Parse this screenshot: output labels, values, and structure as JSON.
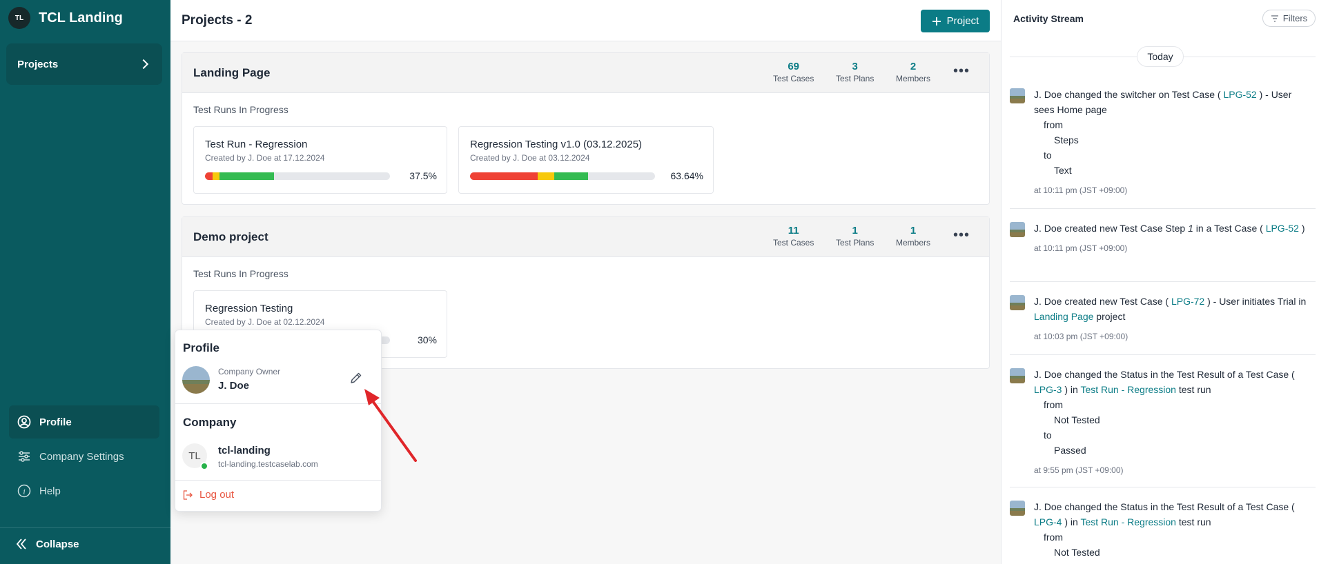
{
  "sidebar": {
    "brand_initials": "TL",
    "brand_title": "TCL Landing",
    "projects_label": "Projects",
    "profile_label": "Profile",
    "company_settings_label": "Company Settings",
    "help_label": "Help",
    "collapse_label": "Collapse"
  },
  "header": {
    "title": "Projects - 2",
    "new_project_label": "Project"
  },
  "projects": [
    {
      "name": "Landing Page",
      "test_cases": "69",
      "test_plans": "3",
      "members": "2",
      "runs_label": "Test Runs In Progress",
      "runs": [
        {
          "title": "Test Run - Regression",
          "meta": "Created by J. Doe at 17.12.2024",
          "percent": "37.5%",
          "red": 0.04,
          "yellow": 0.04,
          "green": 0.295
        },
        {
          "title": "Regression Testing v1.0 (03.12.2025)",
          "meta": "Created by J. Doe at 03.12.2024",
          "percent": "63.64%",
          "red": 0.364,
          "yellow": 0.091,
          "green": 0.182
        }
      ]
    },
    {
      "name": "Demo project",
      "test_cases": "11",
      "test_plans": "1",
      "members": "1",
      "runs_label": "Test Runs In Progress",
      "runs": [
        {
          "title": "Regression Testing",
          "meta": "Created by J. Doe at 02.12.2024",
          "percent": "30%"
        }
      ]
    }
  ],
  "stat_labels": {
    "test_cases": "Test Cases",
    "test_plans": "Test Plans",
    "members": "Members"
  },
  "profile_popup": {
    "profile_heading": "Profile",
    "role": "Company Owner",
    "user_name": "J. Doe",
    "company_heading": "Company",
    "company_initials": "TL",
    "company_name": "tcl-landing",
    "company_domain": "tcl-landing.testcaselab.com",
    "logout_label": "Log out"
  },
  "activity": {
    "title": "Activity Stream",
    "filters_label": "Filters",
    "today_label": "Today",
    "entries": [
      {
        "p1": "J. Doe changed the switcher on Test Case ( ",
        "link1": "LPG-52",
        "p2": " ) - User sees Home page",
        "from_label": "from",
        "from_value": "Steps",
        "to_label": "to",
        "to_value": "Text",
        "time": "at 10:11 pm (JST +09:00)"
      },
      {
        "p1": "J. Doe created new Test Case Step ",
        "step_num": "1",
        "p2": " in a Test Case ( ",
        "link1": "LPG-52",
        "p3": " )",
        "time": "at 10:11 pm (JST +09:00)"
      },
      {
        "p1": "J. Doe created new Test Case ( ",
        "link1": "LPG-72",
        "p2": " ) - User initiates Trial in ",
        "link2": "Landing Page",
        "p3": " project",
        "time": "at 10:03 pm (JST +09:00)"
      },
      {
        "p1": "J. Doe changed the Status in the Test Result of a Test Case ( ",
        "link1": "LPG-3",
        "p2": " ) in ",
        "link2": "Test Run - Regression",
        "p3": " test run",
        "from_label": "from",
        "from_value": "Not Tested",
        "to_label": "to",
        "to_value": "Passed",
        "time": "at 9:55 pm (JST +09:00)"
      },
      {
        "p1": "J. Doe changed the Status in the Test Result of a Test Case ( ",
        "link1": "LPG-4",
        "p2": " ) in ",
        "link2": "Test Run - Regression",
        "p3": " test run",
        "from_label": "from",
        "from_value": "Not Tested"
      }
    ]
  },
  "colors": {
    "sidebar_bg": "#0a5a5f",
    "accent": "#0b7c86",
    "danger": "#e8543f",
    "progress_red": "#ef4235",
    "progress_yellow": "#f7c90c",
    "progress_green": "#34bb52"
  },
  "icons": {
    "projects_chevron": "chevron-right-icon",
    "profile": "user-circle-icon",
    "company_settings": "sliders-icon",
    "help": "info-icon",
    "collapse": "double-chevron-left-icon",
    "new_project": "plus-icon",
    "menu": "more-horizontal-icon",
    "edit": "pencil-icon",
    "logout": "logout-icon",
    "filters": "filter-icon",
    "annotation": "red-arrow-icon"
  }
}
